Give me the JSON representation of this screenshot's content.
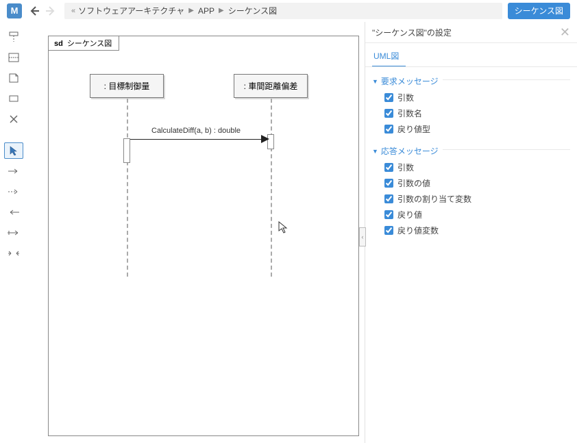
{
  "app_logo": "M",
  "breadcrumb": {
    "first": "«",
    "items": [
      "ソフトウェアアーキテクチャ",
      "APP",
      "シーケンス図"
    ]
  },
  "top_button": "シーケンス図",
  "tools": {
    "group1": [
      "lifeline-tool",
      "fragment-tool",
      "note-tool",
      "rect-tool",
      "delete-tool"
    ],
    "group2": [
      "pointer-tool",
      "message-tool",
      "dashed-message-tool",
      "return-tool",
      "lost-msg-tool",
      "found-msg-tool"
    ]
  },
  "diagram": {
    "frame_tag": "sd",
    "frame_name": "シーケンス図",
    "lifelines": [
      {
        "label": ": 目標制御量"
      },
      {
        "label": ": 車間距離偏差"
      }
    ],
    "message": "CalculateDiff(a, b) : double"
  },
  "right_panel": {
    "title": "\"シーケンス図\"の設定",
    "tab": "UML図",
    "sections": [
      {
        "title": "要求メッセージ",
        "checks": [
          "引数",
          "引数名",
          "戻り値型"
        ]
      },
      {
        "title": "応答メッセージ",
        "checks": [
          "引数",
          "引数の値",
          "引数の割り当て変数",
          "戻り値",
          "戻り値変数"
        ]
      }
    ]
  }
}
